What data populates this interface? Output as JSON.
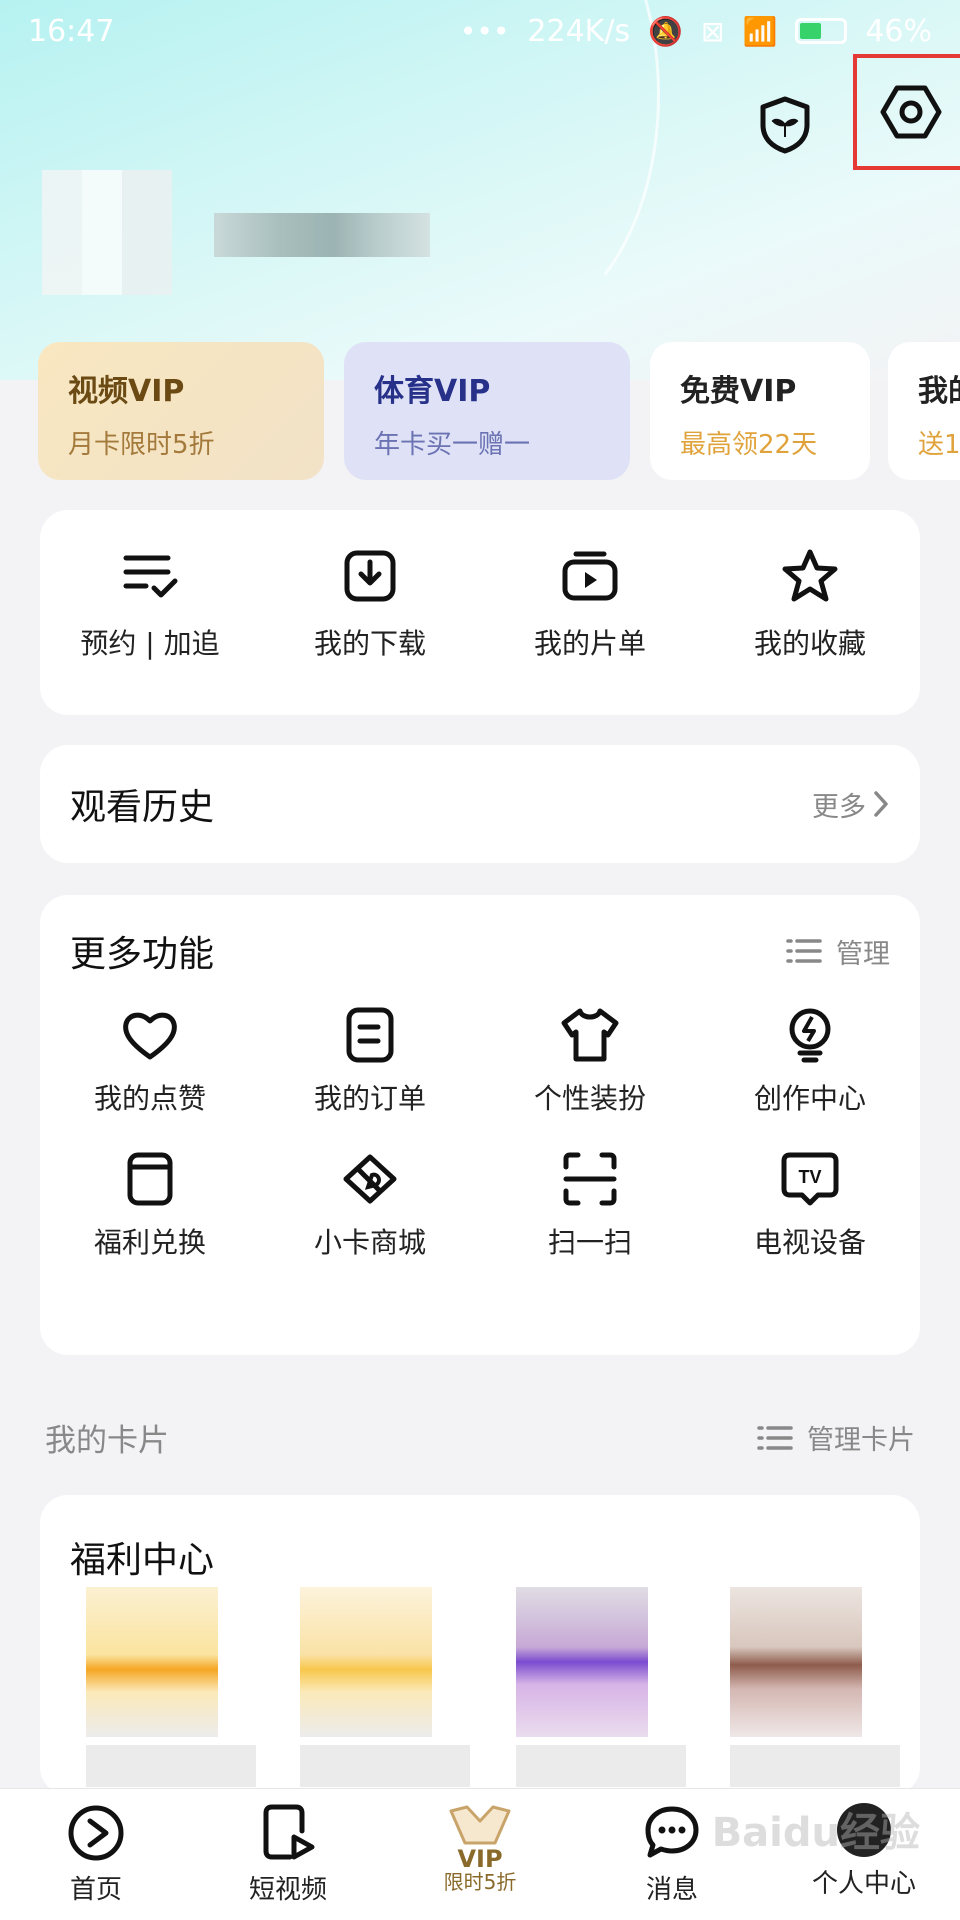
{
  "status_bar": {
    "time": "16:47",
    "network_speed": "224K/s",
    "battery_percent": "46%",
    "icons": [
      "more-dots-icon",
      "mute-icon",
      "sim-icon",
      "wifi-icon",
      "battery-icon"
    ]
  },
  "header": {
    "shield_icon": "shield-plant-icon",
    "settings_icon": "hexagon-settings-icon"
  },
  "vip_cards": [
    {
      "title": "视频VIP",
      "subtitle": "月卡限时5折"
    },
    {
      "title": "体育VIP",
      "subtitle": "年卡买一赠一"
    },
    {
      "title": "免费VIP",
      "subtitle": "最高领22天"
    },
    {
      "title": "我的",
      "subtitle": "送1"
    }
  ],
  "quick_actions": [
    {
      "label": "预约 | 加追",
      "icon": "checklist-icon"
    },
    {
      "label": "我的下载",
      "icon": "download-icon"
    },
    {
      "label": "我的片单",
      "icon": "playlist-icon"
    },
    {
      "label": "我的收藏",
      "icon": "star-icon"
    }
  ],
  "history": {
    "title": "观看历史",
    "more": "更多"
  },
  "features": {
    "title": "更多功能",
    "manage": "管理",
    "items": [
      {
        "label": "我的点赞",
        "icon": "heart-icon"
      },
      {
        "label": "我的订单",
        "icon": "order-icon"
      },
      {
        "label": "个性装扮",
        "icon": "tshirt-icon"
      },
      {
        "label": "创作中心",
        "icon": "bulb-icon"
      },
      {
        "label": "福利兑换",
        "icon": "exchange-icon"
      },
      {
        "label": "小卡商城",
        "icon": "card-store-icon"
      },
      {
        "label": "扫一扫",
        "icon": "scan-icon"
      },
      {
        "label": "电视设备",
        "icon": "tv-icon"
      }
    ]
  },
  "my_cards": {
    "title": "我的卡片",
    "manage": "管理卡片"
  },
  "welfare": {
    "title": "福利中心"
  },
  "tabbar": {
    "home": "首页",
    "short_video": "短视频",
    "vip_label": "VIP",
    "vip_promo": "限时5折",
    "messages": "消息",
    "profile": "个人中心"
  },
  "watermark": "Baidu经验",
  "colors": {
    "accent_red": "#e53935",
    "vip_gold": "#6b4a14",
    "vip_blue": "#27318a",
    "promo_orange": "#e0a33b"
  }
}
